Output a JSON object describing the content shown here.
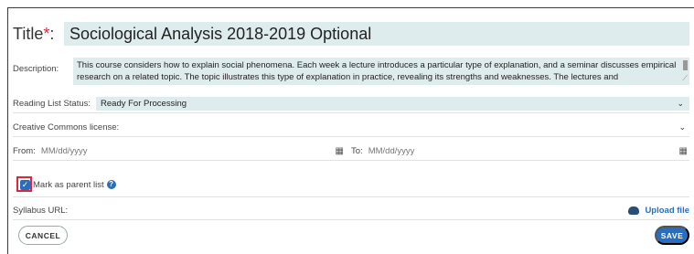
{
  "form": {
    "title_label": "Title",
    "title_required_mark": "*",
    "title_colon": ":",
    "title_value": "Sociological Analysis 2018-2019 Optional",
    "description_label": "Description:",
    "description_value": "This course considers how to explain social phenomena. Each week a lecture introduces a particular type of explanation, and a seminar discusses empirical research on a related topic. The topic illustrates this type of explanation in practice, revealing its strengths and weaknesses. The lectures and",
    "status_label": "Reading List Status:",
    "status_value": "Ready For Processing",
    "cc_label": "Creative Commons license:",
    "from_label": "From:",
    "from_placeholder": "MM/dd/yyyy",
    "to_label": "To:",
    "to_placeholder": "MM/dd/yyyy",
    "parent_checkbox_label": "Mark as parent list",
    "parent_checked": true,
    "syllabus_label": "Syllabus URL:",
    "upload_label": "Upload file"
  },
  "buttons": {
    "cancel": "CANCEL",
    "save": "SAVE"
  },
  "colors": {
    "accent": "#2a6ebb",
    "field_bg": "#dfeced",
    "required": "#e0263a",
    "highlight": "#e0263a"
  },
  "icons": {
    "status_dropdown": "chevron-down-icon",
    "cc_dropdown": "chevron-down-icon",
    "from_calendar": "calendar-icon",
    "to_calendar": "calendar-icon",
    "info": "info-icon",
    "upload": "cloud-upload-icon"
  }
}
